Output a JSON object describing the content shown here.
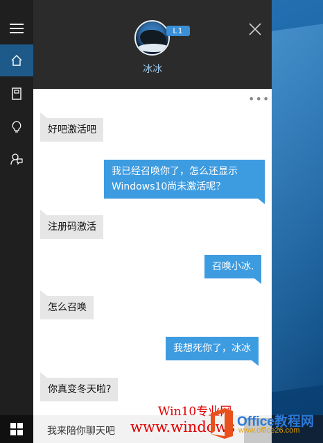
{
  "bot": {
    "name": "冰冰",
    "level": "L1"
  },
  "messages": [
    {
      "side": "left",
      "text": "好吧激活吧"
    },
    {
      "side": "right",
      "text": "我已经召唤你了，怎么还显示Windows10尚未激活呢？"
    },
    {
      "side": "left",
      "text": "注册码激活"
    },
    {
      "side": "right",
      "text": "召唤小冰."
    },
    {
      "side": "left",
      "text": "怎么召唤"
    },
    {
      "side": "right",
      "text": "我想死你了，冰冰"
    },
    {
      "side": "left",
      "text": "你真变冬天啦?"
    }
  ],
  "search": {
    "placeholder": "我来陪你聊天吧"
  },
  "watermark": {
    "line1": "Win10专业网",
    "line2": "www.windows",
    "office": "Office",
    "office_cn": "教程网",
    "url": "www.office26.com"
  },
  "icons": {
    "sidebar": [
      "hamburger-icon",
      "home-icon",
      "notebook-icon",
      "lightbulb-icon",
      "feedback-icon"
    ],
    "start": "windows-logo-icon",
    "close": "close-icon",
    "more": "more-options-icon"
  },
  "colors": {
    "accent": "#3d9be0",
    "sidebar_bg": "#1f1f1f",
    "header_bg": "#2b2b2b",
    "bot_name": "#9cc9ee",
    "user_bubble": "#3d9be0",
    "bot_bubble": "#e6e6e6",
    "watermark_red": "#e00000"
  }
}
